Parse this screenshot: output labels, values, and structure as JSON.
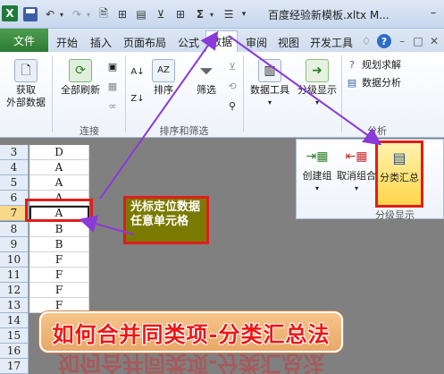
{
  "titlebar": {
    "app_icon": "X",
    "title": "百度经验新模板.xltx M...",
    "icons": [
      "excel-logo-icon",
      "save-icon",
      "undo-icon",
      "redo-icon",
      "print-preview-icon",
      "format-painter-icon",
      "insert-icon",
      "filter-icon",
      "borders-icon",
      "autosum-icon",
      "align-icon",
      "dropdown-icon"
    ],
    "min": "–",
    "max": "□",
    "close": "✕"
  },
  "tabs": {
    "file": "文件",
    "items": [
      "开始",
      "插入",
      "页面布局",
      "公式",
      "数据",
      "审阅",
      "视图",
      "开发工具"
    ],
    "active": "数据"
  },
  "ribbon": {
    "get_external_line1": "获取",
    "get_external_line2": "外部数据",
    "refresh_all": "全部刷新",
    "sort": "排序",
    "filter": "筛选",
    "data_tools": "数据工具",
    "outline": "分级显示",
    "solver": "规划求解",
    "data_analysis": "数据分析",
    "groups": {
      "connections": "连接",
      "sort_filter": "排序和筛选",
      "analysis": "分析"
    }
  },
  "popup": {
    "group": "创建组",
    "ungroup": "取消组合",
    "subtotal": "分类汇总",
    "label": "分级显示"
  },
  "rows": [
    {
      "num": "3",
      "val": "D"
    },
    {
      "num": "4",
      "val": "A"
    },
    {
      "num": "5",
      "val": "A"
    },
    {
      "num": "6",
      "val": "A"
    },
    {
      "num": "7",
      "val": "A"
    },
    {
      "num": "8",
      "val": "B"
    },
    {
      "num": "9",
      "val": "B"
    },
    {
      "num": "10",
      "val": "F"
    },
    {
      "num": "11",
      "val": "F"
    },
    {
      "num": "12",
      "val": "F"
    },
    {
      "num": "13",
      "val": "F"
    },
    {
      "num": "14",
      "val": ""
    },
    {
      "num": "15",
      "val": ""
    },
    {
      "num": "16",
      "val": ""
    },
    {
      "num": "17",
      "val": ""
    }
  ],
  "annotation": "光标定位数据任意单元格",
  "banner": "如何合并同类项-分类汇总法",
  "colors": {
    "annotation_red": "#e11c1c",
    "arrow_purple": "#8a3ad8",
    "file_tab_green": "#2c7b33",
    "banner_text": "#f01414",
    "note_fill": "#7a7a00"
  }
}
